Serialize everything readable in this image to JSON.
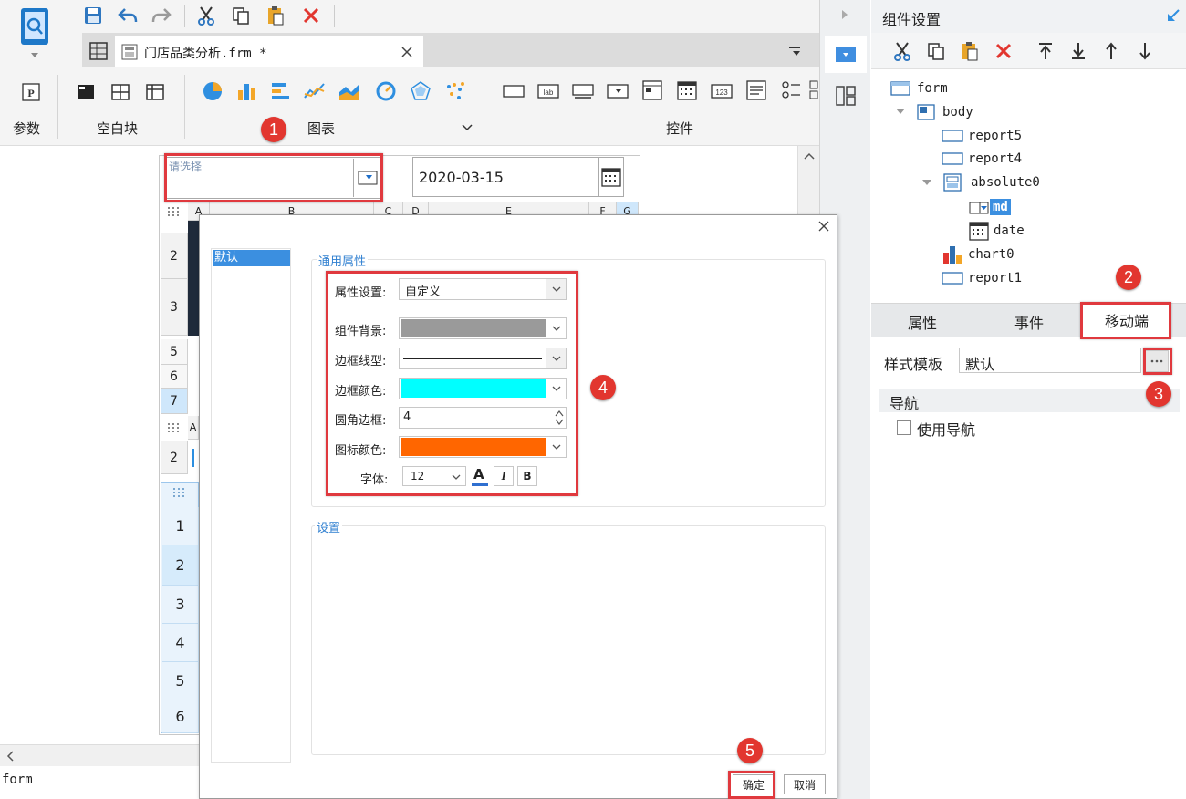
{
  "editor": {
    "tab_title": "门店品类分析.frm *",
    "sections": {
      "param": "参数",
      "blank": "空白块",
      "chart": "图表",
      "widget": "控件"
    },
    "canvas": {
      "combo_placeholder": "请选择",
      "date_value": "2020-03-15",
      "col_headers": [
        "A",
        "B",
        "C",
        "D",
        "E",
        "F",
        "G"
      ],
      "rows_top": [
        "2",
        "3",
        "5",
        "6",
        "7"
      ],
      "row_small": "2",
      "cell_a": "A",
      "rows_bottom": [
        "1",
        "2",
        "3",
        "4",
        "5",
        "6"
      ]
    },
    "status": "form"
  },
  "dialog": {
    "list_item": "默认",
    "group_general": "通用属性",
    "group_settings": "设置",
    "fields": {
      "attr_label": "属性设置:",
      "attr_value": "自定义",
      "bg_label": "组件背景:",
      "line_label": "边框线型:",
      "border_label": "边框颜色:",
      "radius_label": "圆角边框:",
      "radius_value": "4",
      "icon_label": "图标颜色:",
      "font_label": "字体:",
      "font_size": "12",
      "font_color_glyph": "A",
      "italic_glyph": "I",
      "bold_glyph": "B"
    },
    "ok": "确定",
    "cancel": "取消",
    "colors": {
      "bg": "#9a9a9a",
      "border": "#00ffff",
      "icon": "#ff6600"
    }
  },
  "panel": {
    "title": "组件设置",
    "tree": [
      {
        "label": "form"
      },
      {
        "label": "body"
      },
      {
        "label": "report5"
      },
      {
        "label": "report4"
      },
      {
        "label": "absolute0"
      },
      {
        "label": "md"
      },
      {
        "label": "date"
      },
      {
        "label": "chart0"
      },
      {
        "label": "report1"
      }
    ],
    "tabs": [
      "属性",
      "事件",
      "移动端"
    ],
    "style_label": "样式模板",
    "style_value": "默认",
    "nav_header": "导航",
    "nav_checkbox": "使用导航"
  },
  "badges": [
    "1",
    "2",
    "3",
    "4",
    "5"
  ]
}
